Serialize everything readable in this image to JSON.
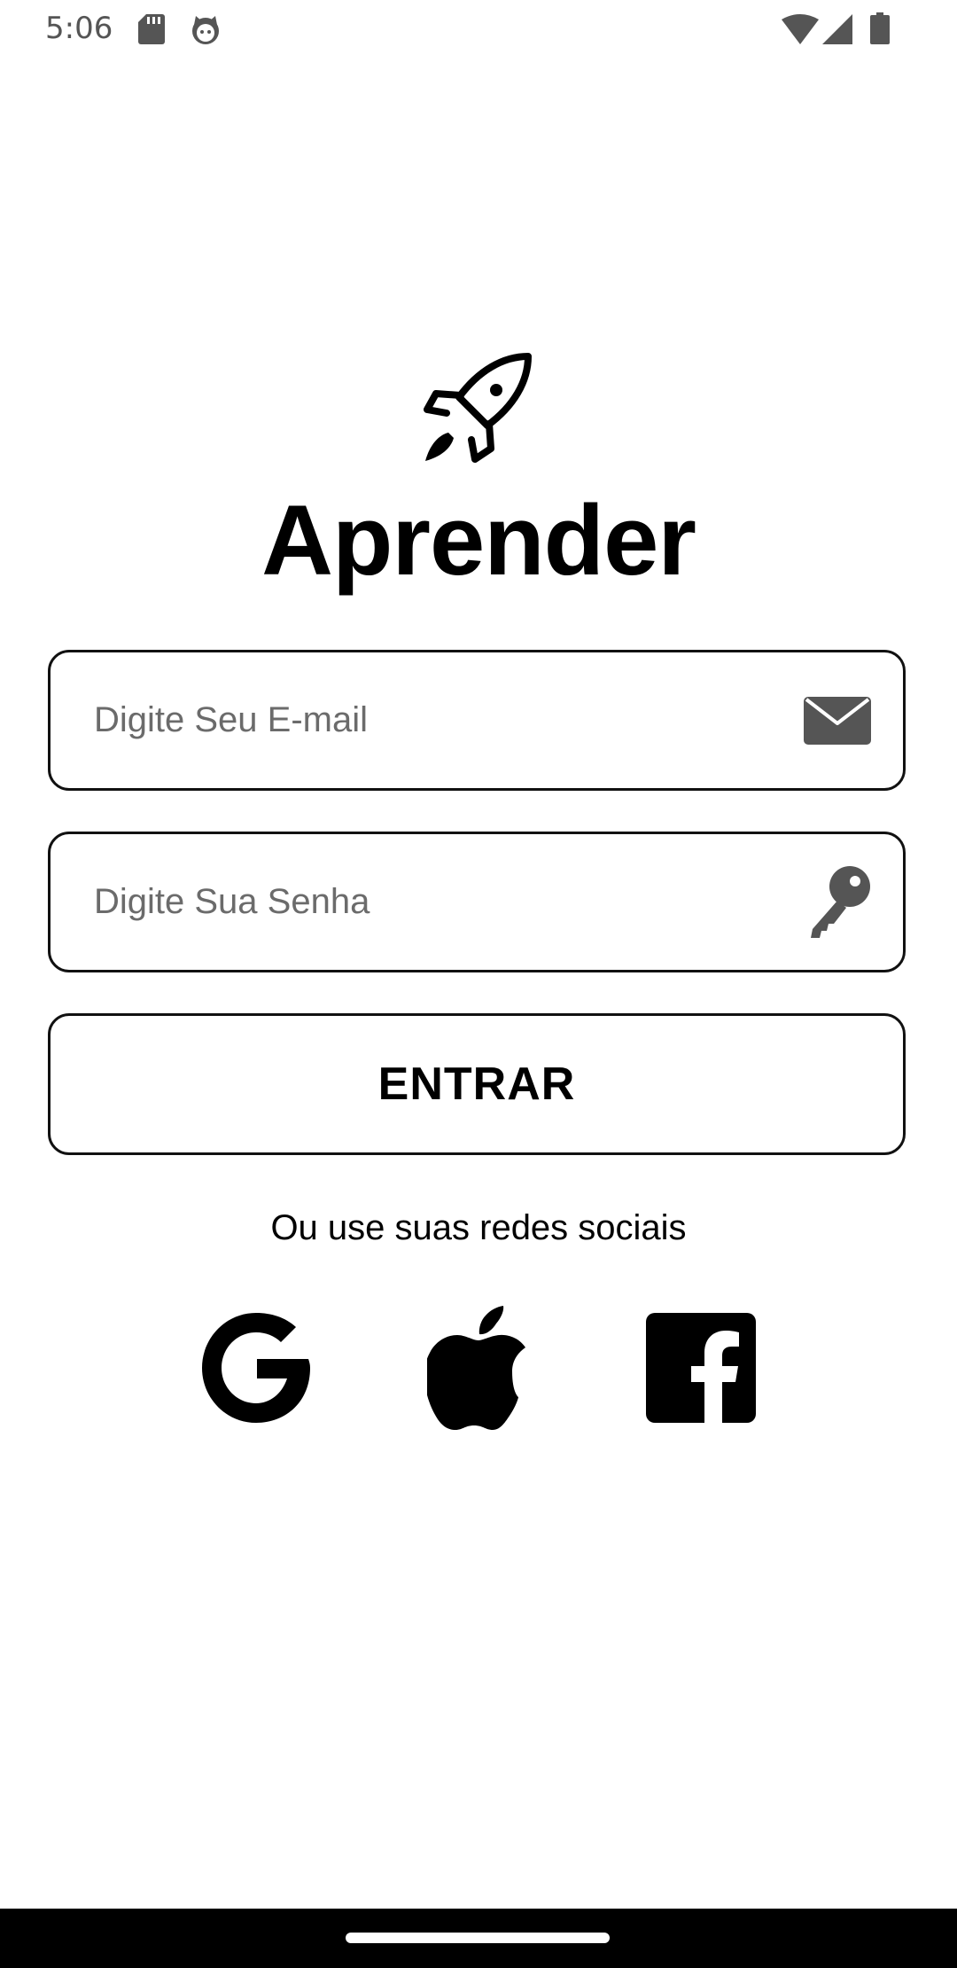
{
  "status_bar": {
    "time": "5:06",
    "icons": [
      "sd-card-icon",
      "cat-icon",
      "wifi-icon",
      "signal-icon",
      "battery-icon"
    ]
  },
  "app": {
    "logo_icon": "rocket-icon",
    "title": "Aprender"
  },
  "form": {
    "email": {
      "placeholder": "Digite Seu E-mail",
      "value": "",
      "icon": "envelope-icon"
    },
    "password": {
      "placeholder": "Digite Sua Senha",
      "value": "",
      "icon": "key-icon"
    },
    "submit_label": "ENTRAR"
  },
  "social": {
    "caption": "Ou use suas redes sociais",
    "providers": [
      "google-icon",
      "apple-icon",
      "facebook-icon"
    ]
  },
  "colors": {
    "text": "#000000",
    "border": "#111111",
    "placeholder": "#6b6b6b",
    "field_icon": "#555555",
    "nav_bar": "#000000"
  }
}
